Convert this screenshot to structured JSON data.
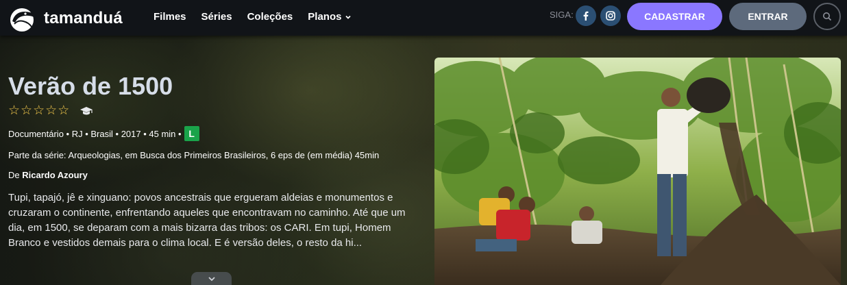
{
  "brand": {
    "name": "tamanduá"
  },
  "nav": {
    "links": [
      "Filmes",
      "Séries",
      "Coleções"
    ],
    "plans_label": "Planos"
  },
  "header": {
    "follow_label": "SIGA:",
    "social": [
      "facebook-icon",
      "instagram-icon"
    ],
    "signup_label": "CADASTRAR",
    "login_label": "ENTRAR",
    "search_icon": "search-icon"
  },
  "film": {
    "title": "Verão de 1500",
    "rating": {
      "value": 0,
      "max": 5
    },
    "genre": "Documentário",
    "state": "RJ",
    "country": "Brasil",
    "year": "2017",
    "duration": "45 min",
    "age_rating": "L",
    "series_text": "Parte da série: Arqueologias, em Busca dos Primeiros Brasileiros, 6 eps de (em média) 45min",
    "director_prefix": "De",
    "director_name": "Ricardo Azoury",
    "synopsis": "Tupi, tapajó, jê e xinguano: povos ancestrais que ergueram aldeias e monumentos e cruzaram o continente, enfrentando aqueles que encontravam no caminho. Até que um dia, em 1500, se deparam com a mais bizarra das tribos: os CARI. Em tupi, Homem Branco e vestidos demais para o clima local. E é versão deles, o resto da hi..."
  },
  "colors": {
    "navbar": "#111418",
    "signup": "#8a77ff",
    "login": "#5d6a7c",
    "star": "#f3c84c",
    "age_badge": "#1aa34a",
    "social": "#2b4f73"
  }
}
